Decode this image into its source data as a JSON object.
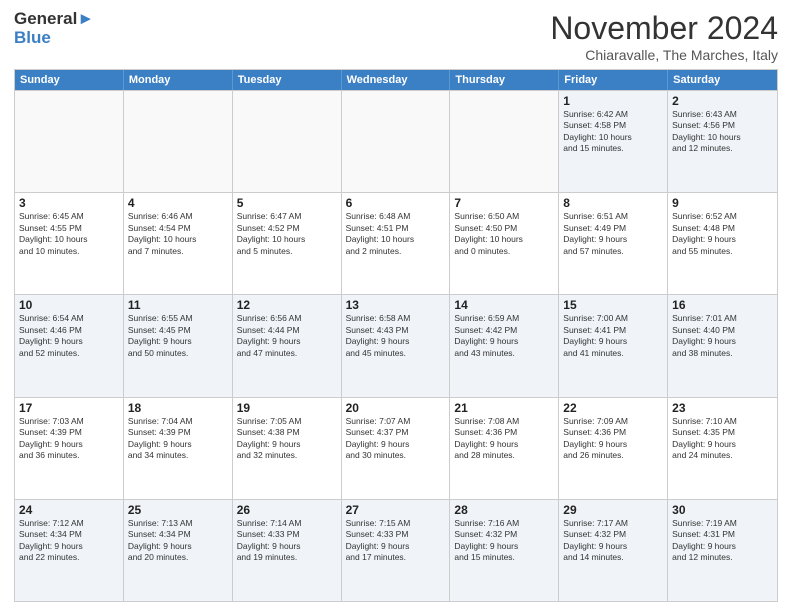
{
  "header": {
    "logo_line1": "General",
    "logo_line2": "Blue",
    "month_title": "November 2024",
    "location": "Chiaravalle, The Marches, Italy"
  },
  "weekdays": [
    "Sunday",
    "Monday",
    "Tuesday",
    "Wednesday",
    "Thursday",
    "Friday",
    "Saturday"
  ],
  "rows": [
    [
      {
        "day": "",
        "info": ""
      },
      {
        "day": "",
        "info": ""
      },
      {
        "day": "",
        "info": ""
      },
      {
        "day": "",
        "info": ""
      },
      {
        "day": "",
        "info": ""
      },
      {
        "day": "1",
        "info": "Sunrise: 6:42 AM\nSunset: 4:58 PM\nDaylight: 10 hours\nand 15 minutes."
      },
      {
        "day": "2",
        "info": "Sunrise: 6:43 AM\nSunset: 4:56 PM\nDaylight: 10 hours\nand 12 minutes."
      }
    ],
    [
      {
        "day": "3",
        "info": "Sunrise: 6:45 AM\nSunset: 4:55 PM\nDaylight: 10 hours\nand 10 minutes."
      },
      {
        "day": "4",
        "info": "Sunrise: 6:46 AM\nSunset: 4:54 PM\nDaylight: 10 hours\nand 7 minutes."
      },
      {
        "day": "5",
        "info": "Sunrise: 6:47 AM\nSunset: 4:52 PM\nDaylight: 10 hours\nand 5 minutes."
      },
      {
        "day": "6",
        "info": "Sunrise: 6:48 AM\nSunset: 4:51 PM\nDaylight: 10 hours\nand 2 minutes."
      },
      {
        "day": "7",
        "info": "Sunrise: 6:50 AM\nSunset: 4:50 PM\nDaylight: 10 hours\nand 0 minutes."
      },
      {
        "day": "8",
        "info": "Sunrise: 6:51 AM\nSunset: 4:49 PM\nDaylight: 9 hours\nand 57 minutes."
      },
      {
        "day": "9",
        "info": "Sunrise: 6:52 AM\nSunset: 4:48 PM\nDaylight: 9 hours\nand 55 minutes."
      }
    ],
    [
      {
        "day": "10",
        "info": "Sunrise: 6:54 AM\nSunset: 4:46 PM\nDaylight: 9 hours\nand 52 minutes."
      },
      {
        "day": "11",
        "info": "Sunrise: 6:55 AM\nSunset: 4:45 PM\nDaylight: 9 hours\nand 50 minutes."
      },
      {
        "day": "12",
        "info": "Sunrise: 6:56 AM\nSunset: 4:44 PM\nDaylight: 9 hours\nand 47 minutes."
      },
      {
        "day": "13",
        "info": "Sunrise: 6:58 AM\nSunset: 4:43 PM\nDaylight: 9 hours\nand 45 minutes."
      },
      {
        "day": "14",
        "info": "Sunrise: 6:59 AM\nSunset: 4:42 PM\nDaylight: 9 hours\nand 43 minutes."
      },
      {
        "day": "15",
        "info": "Sunrise: 7:00 AM\nSunset: 4:41 PM\nDaylight: 9 hours\nand 41 minutes."
      },
      {
        "day": "16",
        "info": "Sunrise: 7:01 AM\nSunset: 4:40 PM\nDaylight: 9 hours\nand 38 minutes."
      }
    ],
    [
      {
        "day": "17",
        "info": "Sunrise: 7:03 AM\nSunset: 4:39 PM\nDaylight: 9 hours\nand 36 minutes."
      },
      {
        "day": "18",
        "info": "Sunrise: 7:04 AM\nSunset: 4:39 PM\nDaylight: 9 hours\nand 34 minutes."
      },
      {
        "day": "19",
        "info": "Sunrise: 7:05 AM\nSunset: 4:38 PM\nDaylight: 9 hours\nand 32 minutes."
      },
      {
        "day": "20",
        "info": "Sunrise: 7:07 AM\nSunset: 4:37 PM\nDaylight: 9 hours\nand 30 minutes."
      },
      {
        "day": "21",
        "info": "Sunrise: 7:08 AM\nSunset: 4:36 PM\nDaylight: 9 hours\nand 28 minutes."
      },
      {
        "day": "22",
        "info": "Sunrise: 7:09 AM\nSunset: 4:36 PM\nDaylight: 9 hours\nand 26 minutes."
      },
      {
        "day": "23",
        "info": "Sunrise: 7:10 AM\nSunset: 4:35 PM\nDaylight: 9 hours\nand 24 minutes."
      }
    ],
    [
      {
        "day": "24",
        "info": "Sunrise: 7:12 AM\nSunset: 4:34 PM\nDaylight: 9 hours\nand 22 minutes."
      },
      {
        "day": "25",
        "info": "Sunrise: 7:13 AM\nSunset: 4:34 PM\nDaylight: 9 hours\nand 20 minutes."
      },
      {
        "day": "26",
        "info": "Sunrise: 7:14 AM\nSunset: 4:33 PM\nDaylight: 9 hours\nand 19 minutes."
      },
      {
        "day": "27",
        "info": "Sunrise: 7:15 AM\nSunset: 4:33 PM\nDaylight: 9 hours\nand 17 minutes."
      },
      {
        "day": "28",
        "info": "Sunrise: 7:16 AM\nSunset: 4:32 PM\nDaylight: 9 hours\nand 15 minutes."
      },
      {
        "day": "29",
        "info": "Sunrise: 7:17 AM\nSunset: 4:32 PM\nDaylight: 9 hours\nand 14 minutes."
      },
      {
        "day": "30",
        "info": "Sunrise: 7:19 AM\nSunset: 4:31 PM\nDaylight: 9 hours\nand 12 minutes."
      }
    ]
  ]
}
